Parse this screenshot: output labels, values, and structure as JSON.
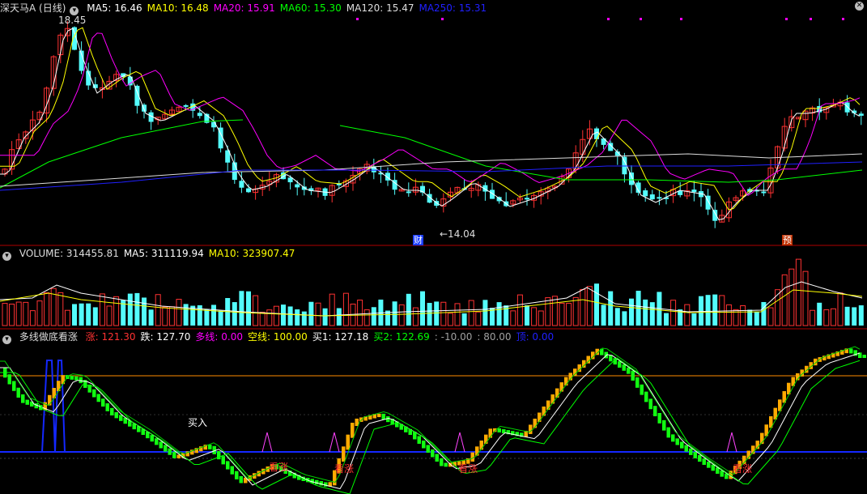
{
  "colors": {
    "background": "#000000",
    "up": "#ff3232",
    "down": "#54fcfc",
    "ma5": "#ffffff",
    "ma10": "#ffff00",
    "ma20": "#ff00ff",
    "ma60": "#00ff00",
    "ma120": "#dddddd",
    "ma250": "#2020ff",
    "divider": "#b00000",
    "orange_line": "#ff8c00",
    "blue_line": "#1428ff"
  },
  "price_panel": {
    "title": "深天马A (日线)",
    "indicators": [
      {
        "label": "MA5: 16.46",
        "color": "#ffffff"
      },
      {
        "label": "MA10: 16.48",
        "color": "#ffff00"
      },
      {
        "label": "MA20: 15.91",
        "color": "#ff00ff"
      },
      {
        "label": "MA60: 15.30",
        "color": "#00ff00"
      },
      {
        "label": "MA120: 15.47",
        "color": "#dddddd"
      },
      {
        "label": "MA250: 15.31",
        "color": "#2020ff"
      }
    ],
    "high_label": "18.45",
    "low_label": "←14.04",
    "tag_cai": "财",
    "tag_yu": "预"
  },
  "volume_panel": {
    "indicators": [
      {
        "label": "VOLUME: 314455.81",
        "color": "#dddddd"
      },
      {
        "label": "MA5: 311119.94",
        "color": "#ffffff"
      },
      {
        "label": "MA10: 323907.47",
        "color": "#ffff00"
      }
    ]
  },
  "indicator_panel": {
    "name": "多线做底看涨",
    "indicators": [
      {
        "label": "涨: 121.30",
        "color": "#ff3232"
      },
      {
        "label": "跌: 127.70",
        "color": "#ffffff"
      },
      {
        "label": "多线: 0.00",
        "color": "#ff00ff"
      },
      {
        "label": "空线: 100.00",
        "color": "#ffff00"
      },
      {
        "label": "买1: 127.18",
        "color": "#ffffff"
      },
      {
        "label": "买2: 122.69",
        "color": "#00ff00"
      },
      {
        "label": ": -10.00",
        "color": "#a0a0a0"
      },
      {
        "label": ": 80.00",
        "color": "#a0a0a0"
      },
      {
        "label": "顶: 0.00",
        "color": "#2020ff"
      }
    ],
    "buy_label": "买入",
    "signal_label": "看涨"
  },
  "icons": {
    "panel_menu": "circle-down-icon",
    "close": "close-icon"
  }
}
